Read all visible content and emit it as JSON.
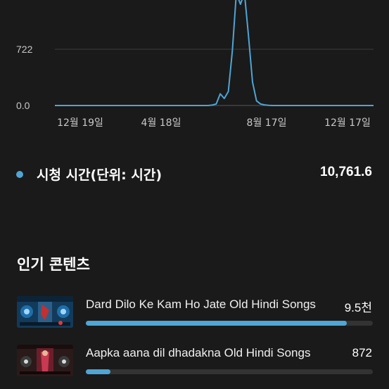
{
  "chart_data": {
    "type": "line",
    "y_ticks": [
      "722",
      "0.0"
    ],
    "ylim": [
      0,
      1444
    ],
    "x_tick_labels": [
      "12월 19일",
      "4월 18일",
      "8월 17일",
      "12월 17일"
    ],
    "series": [
      {
        "color": "#4fa5d5",
        "values": [
          0,
          0,
          0,
          0,
          0,
          0,
          0,
          0,
          0,
          0,
          0,
          0,
          0,
          0,
          0,
          0,
          0,
          0,
          0,
          0,
          0,
          0,
          0,
          0,
          0,
          0,
          0,
          0,
          0,
          0,
          0,
          0,
          0,
          0,
          0,
          0,
          0,
          0,
          0,
          5,
          20,
          150,
          90,
          180,
          700,
          1444,
          1300,
          1444,
          900,
          300,
          60,
          20,
          8,
          3,
          0,
          0,
          0,
          0,
          0,
          0,
          0,
          0,
          0,
          0,
          0,
          0,
          0,
          0,
          0,
          0,
          0,
          0,
          0,
          0,
          0,
          0,
          0,
          0,
          0,
          0
        ]
      }
    ],
    "grid": true,
    "legend": "none"
  },
  "metric": {
    "label": "시청 시간(단위: 시간)",
    "value": "10,761.6",
    "dot_color": "#4fa5d5"
  },
  "popular": {
    "title": "인기 콘텐츠",
    "items": [
      {
        "title": "Dard Dilo Ke Kam Ho Jate Old Hindi Songs",
        "count": "9.5천",
        "share": 0.91,
        "thumb_icon": "video-thumbnail-icon"
      },
      {
        "title": "Aapka aana dil dhadakna Old Hindi Songs",
        "count": "872",
        "share": 0.085,
        "thumb_icon": "video-thumbnail-icon"
      }
    ]
  }
}
